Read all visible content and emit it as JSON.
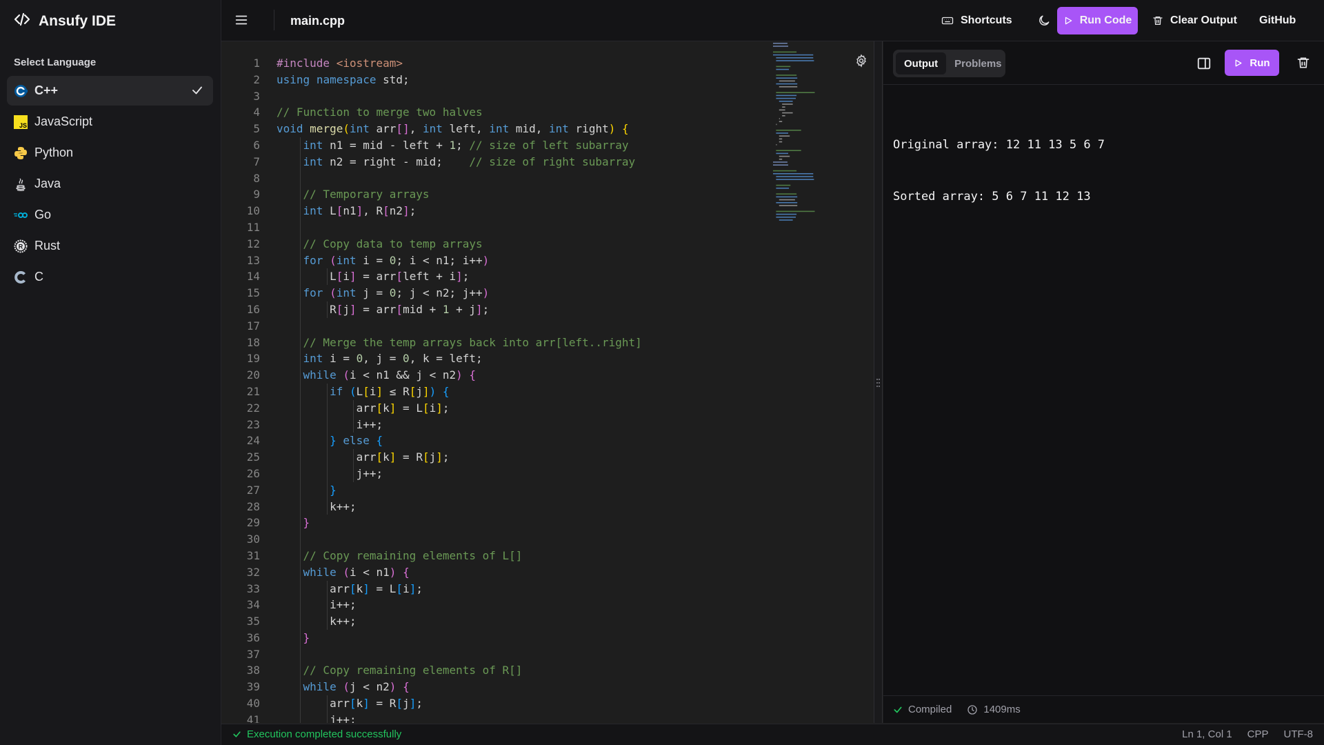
{
  "app": {
    "title": "Ansufy IDE"
  },
  "sidebar": {
    "section_title": "Select Language",
    "items": [
      {
        "label": "C++",
        "icon": "cpp-logo-icon",
        "active": true
      },
      {
        "label": "JavaScript",
        "icon": "javascript-logo-icon"
      },
      {
        "label": "Python",
        "icon": "python-logo-icon"
      },
      {
        "label": "Java",
        "icon": "java-logo-icon"
      },
      {
        "label": "Go",
        "icon": "go-logo-icon"
      },
      {
        "label": "Rust",
        "icon": "rust-logo-icon"
      },
      {
        "label": "C",
        "icon": "c-logo-icon"
      }
    ]
  },
  "topbar": {
    "file_name": "main.cpp",
    "shortcuts_label": "Shortcuts",
    "run_code_label": "Run Code",
    "clear_output_label": "Clear Output",
    "github_label": "GitHub"
  },
  "editor": {
    "language": "cpp",
    "code": [
      "#include <iostream>",
      "using namespace std;",
      "",
      "// Function to merge two halves",
      "void merge(int arr[], int left, int mid, int right) {",
      "    int n1 = mid - left + 1; // size of left subarray",
      "    int n2 = right - mid;    // size of right subarray",
      "",
      "    // Temporary arrays",
      "    int L[n1], R[n2];",
      "",
      "    // Copy data to temp arrays",
      "    for (int i = 0; i < n1; i++)",
      "        L[i] = arr[left + i];",
      "    for (int j = 0; j < n2; j++)",
      "        R[j] = arr[mid + 1 + j];",
      "",
      "    // Merge the temp arrays back into arr[left..right]",
      "    int i = 0, j = 0, k = left;",
      "    while (i < n1 && j < n2) {",
      "        if (L[i] ≤ R[j]) {",
      "            arr[k] = L[i];",
      "            i++;",
      "        } else {",
      "            arr[k] = R[j];",
      "            j++;",
      "        }",
      "        k++;",
      "    }",
      "",
      "    // Copy remaining elements of L[]",
      "    while (i < n1) {",
      "        arr[k] = L[i];",
      "        i++;",
      "        k++;",
      "    }",
      "",
      "    // Copy remaining elements of R[]",
      "    while (j < n2) {",
      "        arr[k] = R[j];",
      "        j++;"
    ]
  },
  "output": {
    "tabs": [
      {
        "label": "Output",
        "active": true
      },
      {
        "label": "Problems"
      }
    ],
    "run_label": "Run",
    "lines": [
      "Original array: 12 11 13 5 6 7",
      "Sorted array: 5 6 7 11 12 13"
    ],
    "compiled_label": "Compiled",
    "time_label": "1409ms"
  },
  "statusbar": {
    "message": "Execution completed successfully",
    "position": "Ln 1, Col 1",
    "language": "CPP",
    "encoding": "UTF-8"
  },
  "colors": {
    "accent": "#a855f7",
    "success": "#22c55e"
  }
}
